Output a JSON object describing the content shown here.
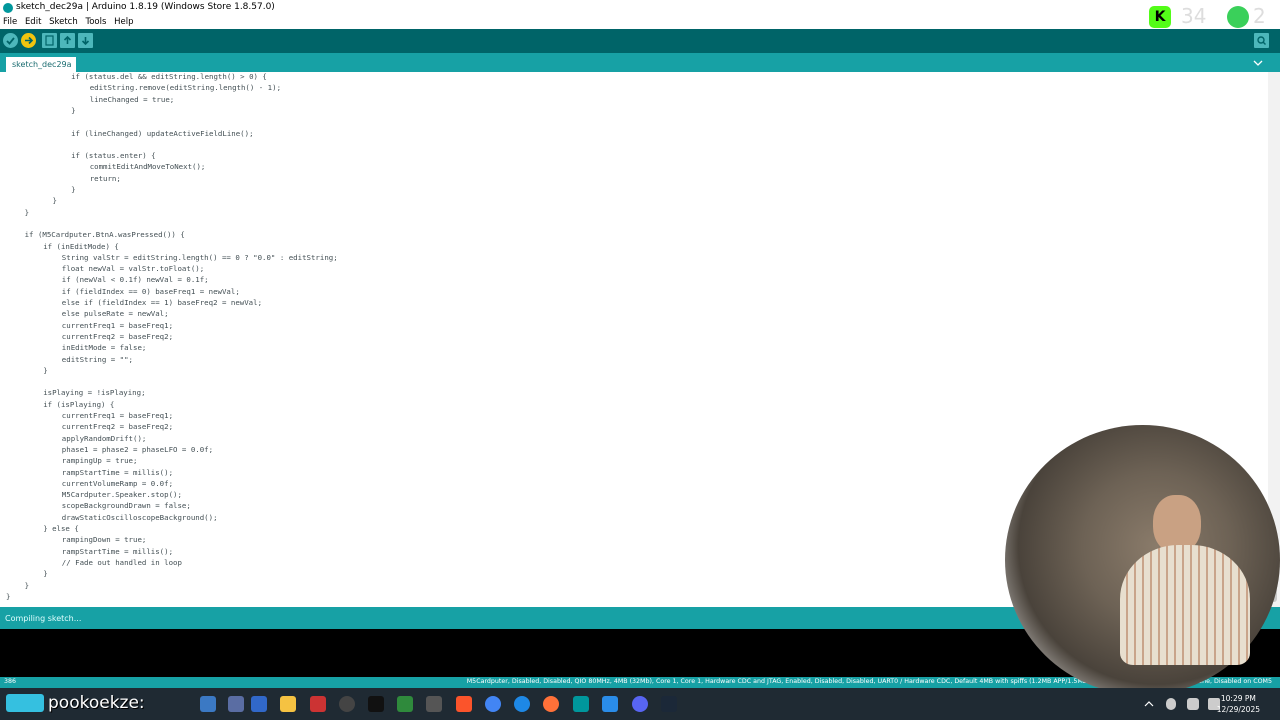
{
  "window": {
    "title": "sketch_dec29a | Arduino 1.8.19 (Windows Store 1.8.57.0)"
  },
  "menu": [
    "File",
    "Edit",
    "Sketch",
    "Tools",
    "Help"
  ],
  "tab": {
    "label": "sketch_dec29a §"
  },
  "code": [
    {
      "indent": 7,
      "text": "if (status.del && editString.length() > 0) {"
    },
    {
      "indent": 9,
      "text": "editString.remove(editString.length() - 1);"
    },
    {
      "indent": 9,
      "text": "lineChanged = true;"
    },
    {
      "indent": 7,
      "text": "}"
    },
    {
      "indent": 0,
      "text": ""
    },
    {
      "indent": 7,
      "text": "if (lineChanged) updateActiveFieldLine();"
    },
    {
      "indent": 0,
      "text": ""
    },
    {
      "indent": 7,
      "text": "if (status.enter) {"
    },
    {
      "indent": 9,
      "text": "commitEditAndMoveToNext();"
    },
    {
      "indent": 9,
      "text": "return;"
    },
    {
      "indent": 7,
      "text": "}"
    },
    {
      "indent": 5,
      "text": "}"
    },
    {
      "indent": 2,
      "text": "}"
    },
    {
      "indent": 0,
      "text": ""
    },
    {
      "indent": 2,
      "text": "if (M5Cardputer.BtnA.wasPressed()) {"
    },
    {
      "indent": 4,
      "text": "if (inEditMode) {"
    },
    {
      "indent": 6,
      "text": "String valStr = editString.length() == 0 ? \"0.0\" : editString;"
    },
    {
      "indent": 6,
      "text": "float newVal = valStr.toFloat();"
    },
    {
      "indent": 6,
      "text": "if (newVal < 0.1f) newVal = 0.1f;"
    },
    {
      "indent": 6,
      "text": "if (fieldIndex == 0) baseFreq1 = newVal;"
    },
    {
      "indent": 6,
      "text": "else if (fieldIndex == 1) baseFreq2 = newVal;"
    },
    {
      "indent": 6,
      "text": "else pulseRate = newVal;"
    },
    {
      "indent": 6,
      "text": "currentFreq1 = baseFreq1;"
    },
    {
      "indent": 6,
      "text": "currentFreq2 = baseFreq2;"
    },
    {
      "indent": 6,
      "text": "inEditMode = false;"
    },
    {
      "indent": 6,
      "text": "editString = \"\";"
    },
    {
      "indent": 4,
      "text": "}"
    },
    {
      "indent": 0,
      "text": ""
    },
    {
      "indent": 4,
      "text": "isPlaying = !isPlaying;"
    },
    {
      "indent": 4,
      "text": "if (isPlaying) {"
    },
    {
      "indent": 6,
      "text": "currentFreq1 = baseFreq1;"
    },
    {
      "indent": 6,
      "text": "currentFreq2 = baseFreq2;"
    },
    {
      "indent": 6,
      "text": "applyRandomDrift();"
    },
    {
      "indent": 6,
      "text": "phase1 = phase2 = phaseLFO = 0.0f;"
    },
    {
      "indent": 6,
      "text": "rampingUp = true;"
    },
    {
      "indent": 6,
      "text": "rampStartTime = millis();"
    },
    {
      "indent": 6,
      "text": "currentVolumeRamp = 0.0f;"
    },
    {
      "indent": 6,
      "text": "M5Cardputer.Speaker.stop();"
    },
    {
      "indent": 6,
      "text": "scopeBackgroundDrawn = false;"
    },
    {
      "indent": 6,
      "text": "drawStaticOscilloscopeBackground();"
    },
    {
      "indent": 4,
      "text": "} else {"
    },
    {
      "indent": 6,
      "text": "rampingDown = true;"
    },
    {
      "indent": 6,
      "text": "rampStartTime = millis();"
    },
    {
      "indent": 6,
      "text": "// Fade out handled in loop"
    },
    {
      "indent": 4,
      "text": "}"
    },
    {
      "indent": 2,
      "text": "}"
    },
    {
      "indent": 0,
      "text": "}"
    }
  ],
  "status": {
    "message": "Compiling sketch..."
  },
  "footer": {
    "line_number": "386",
    "board_info": "M5Cardputer, Disabled, Disabled, QIO 80MHz, 4MB (32Mb), Core 1, Core 1, Hardware CDC and JTAG, Enabled, Disabled, Disabled, UART0 / Hardware CDC, Default 4MB with spiffs (1.2MB APP/1.5MB SPIFFS), 240MHz (WiFi), 921600, None, Disabled on COM5"
  },
  "taskbar": {
    "time": "10:29 PM",
    "date": "12/29/2025",
    "streamer_tag": "pookoekze:"
  },
  "overlay": {
    "kick_letter": "K",
    "num1": "34",
    "num2": "2"
  },
  "colors": {
    "accent": "#00979c",
    "toolbar": "#006468",
    "tabs": "#17a1a5"
  }
}
